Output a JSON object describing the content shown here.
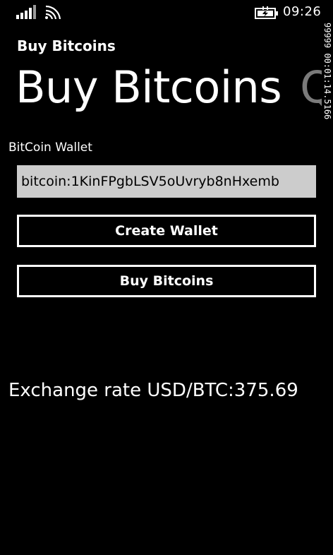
{
  "status_bar": {
    "signal_icon": "signal-strength-icon",
    "wifi_icon": "wifi-icon",
    "battery_icon": "battery-charging-icon",
    "time": "09:26"
  },
  "app": {
    "title": "Buy Bitcoins"
  },
  "pivot": {
    "items": [
      {
        "label": "Buy Bitcoins"
      },
      {
        "label": "Q"
      }
    ]
  },
  "debug": {
    "text": "99999 00:01:14.5166"
  },
  "wallet": {
    "label": "BitCoin Wallet",
    "value": "bitcoin:1KinFPgbLSV5oUvryb8nHxemb"
  },
  "buttons": {
    "create_wallet": "Create Wallet",
    "buy_bitcoins": "Buy Bitcoins"
  },
  "exchange": {
    "text": "Exchange rate USD/BTC:375.69"
  }
}
